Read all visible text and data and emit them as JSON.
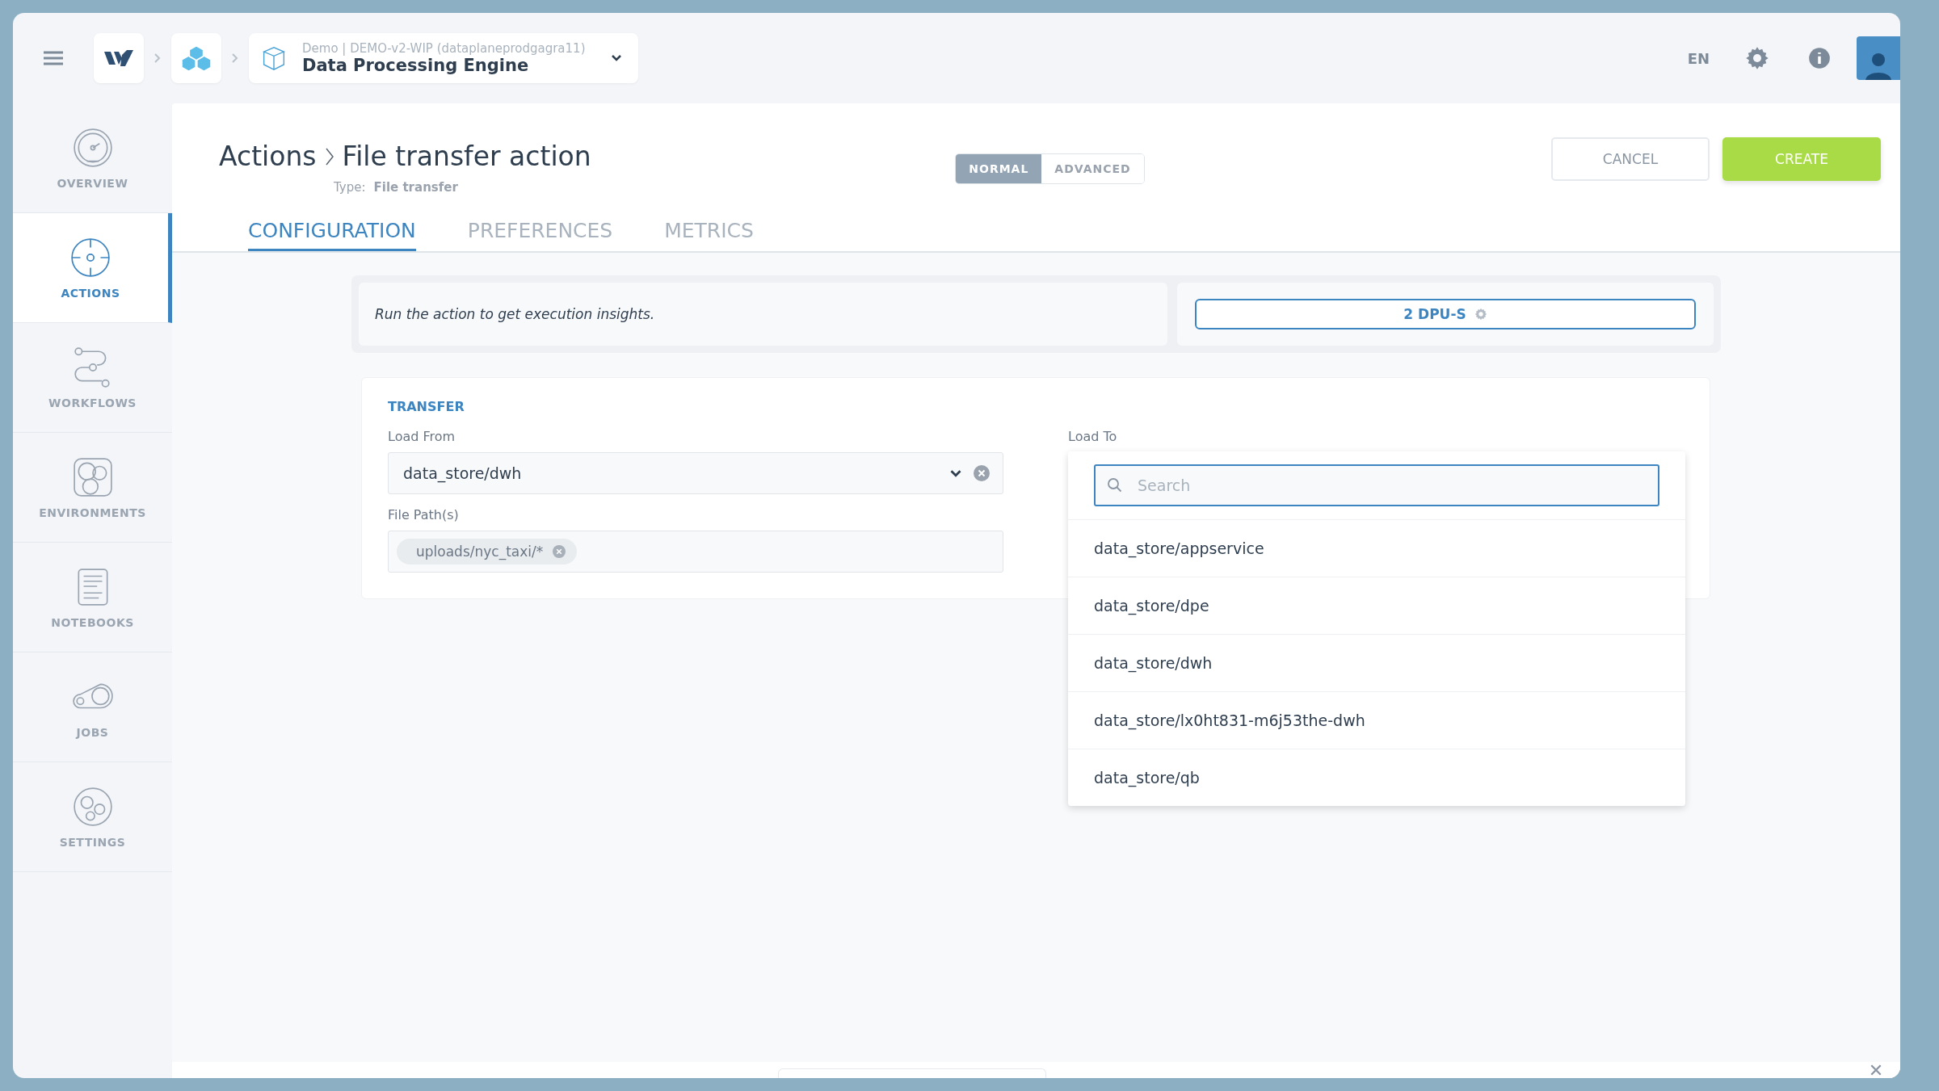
{
  "topbar": {
    "context": "Demo | DEMO-v2-WIP (dataplaneprodgagra11)",
    "title": "Data Processing Engine",
    "language": "EN"
  },
  "sidebar": {
    "items": [
      {
        "label": "OVERVIEW",
        "selected": false
      },
      {
        "label": "ACTIONS",
        "selected": true
      },
      {
        "label": "WORKFLOWS",
        "selected": false
      },
      {
        "label": "ENVIRONMENTS",
        "selected": false
      },
      {
        "label": "NOTEBOOKS",
        "selected": false
      },
      {
        "label": "JOBS",
        "selected": false
      },
      {
        "label": "SETTINGS",
        "selected": false
      }
    ]
  },
  "header": {
    "breadcrumb": [
      "Actions",
      "File transfer action"
    ],
    "type_label": "Type:",
    "type_value": "File transfer",
    "mode_toggle": [
      {
        "label": "NORMAL",
        "selected": true
      },
      {
        "label": "ADVANCED",
        "selected": false
      }
    ],
    "buttons": [
      {
        "label": "CANCEL",
        "kind": "secondary"
      },
      {
        "label": "CREATE",
        "kind": "primary"
      }
    ]
  },
  "tabs": [
    {
      "label": "CONFIGURATION",
      "selected": true
    },
    {
      "label": "PREFERENCES",
      "selected": false
    },
    {
      "label": "METRICS",
      "selected": false
    }
  ],
  "insights": {
    "message": "Run the action to get execution insights.",
    "dpu_button": "2 DPU-S"
  },
  "transfer": {
    "title": "TRANSFER",
    "load_from": {
      "label": "Load From",
      "value": "data_store/dwh"
    },
    "file_paths": {
      "label": "File Path(s)",
      "tags": [
        "uploads/nyc_taxi/*"
      ]
    },
    "load_to": {
      "label": "Load To",
      "dropdown": {
        "search_placeholder": "Search",
        "options": [
          "data_store/appservice",
          "data_store/dpe",
          "data_store/dwh",
          "data_store/lx0ht831-m6j53the-dwh",
          "data_store/qb"
        ]
      }
    }
  }
}
